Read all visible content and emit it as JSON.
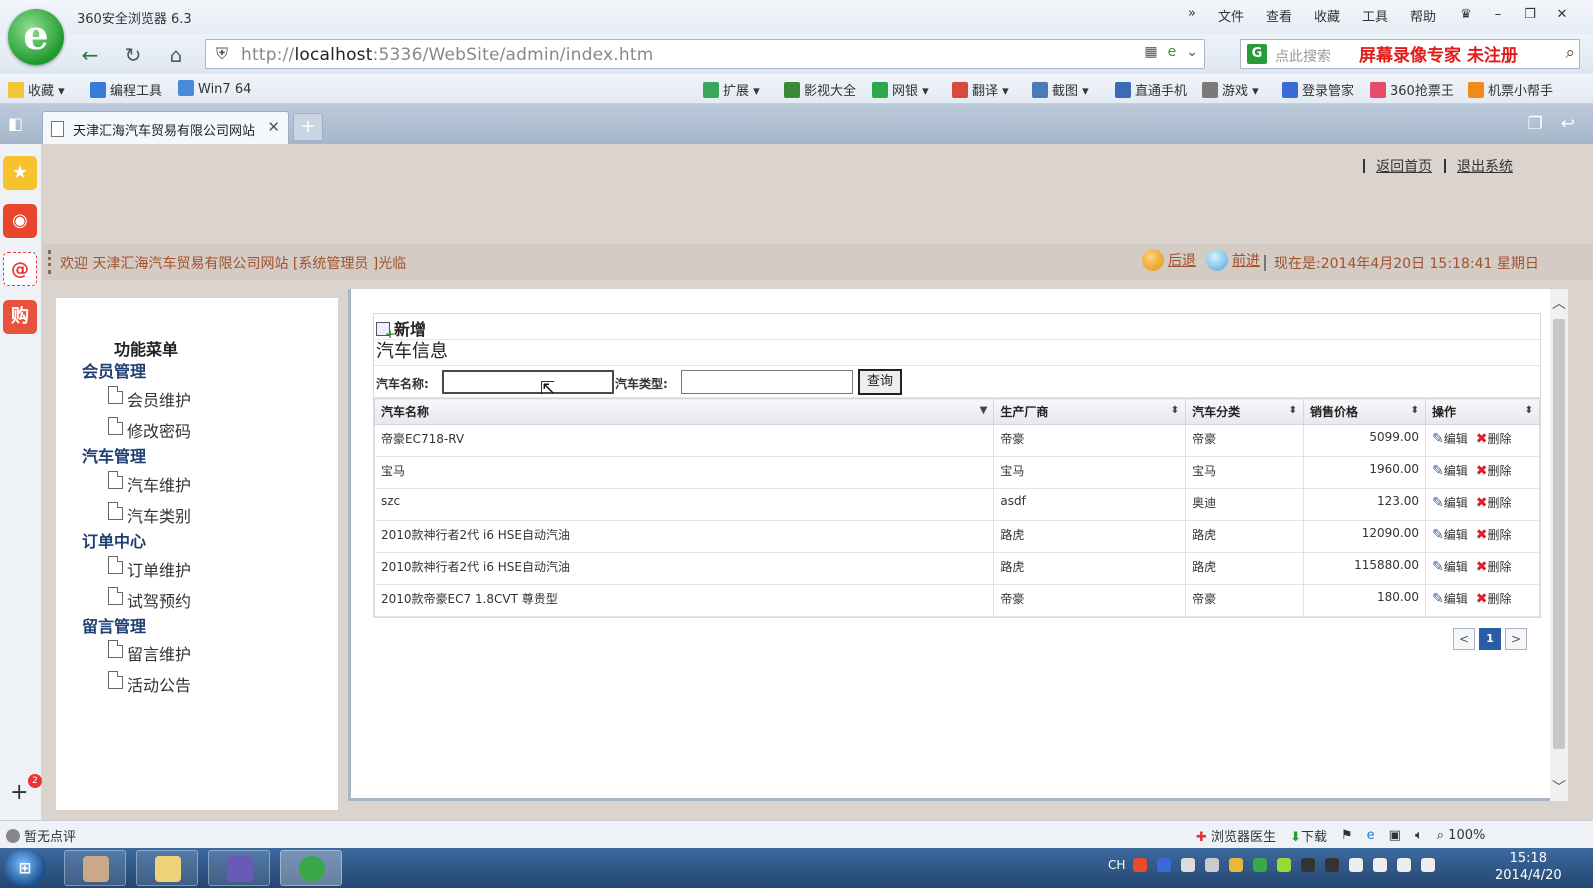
{
  "browser": {
    "title": "360安全浏览器 6.3",
    "logo_glyph": "e",
    "top_menu": [
      "文件",
      "查看",
      "收藏",
      "工具",
      "帮助"
    ],
    "url_host": "localhost",
    "url_prefix": "http://",
    "url_rest": ":5336/WebSite/admin/index.htm",
    "search_placeholder": "点此搜索",
    "watermark": "屏幕录像专家  未注册",
    "favorites": [
      "收藏",
      "编程工具",
      "Win7 64",
      "扩展",
      "影视大全",
      "网银",
      "翻译",
      "截图",
      "直通手机",
      "游戏",
      "登录管家",
      "360抢票王",
      "机票小帮手"
    ],
    "tab_title": "天津汇海汽车贸易有限公司网站",
    "dock_badge": "2"
  },
  "header": {
    "home_link": "返回首页",
    "logout_link": "退出系统",
    "welcome": "欢迎  天津汇海汽车贸易有限公司网站 [系统管理员 ]光临",
    "back": "后退",
    "forward": "前进",
    "now": "现在是:2014年4月20日  15:18:41 星期日"
  },
  "menu": {
    "title": "功能菜单",
    "groups": [
      {
        "label": "会员管理",
        "items": [
          "会员维护",
          "修改密码"
        ]
      },
      {
        "label": "汽车管理",
        "items": [
          "汽车维护",
          "汽车类别"
        ]
      },
      {
        "label": "订单中心",
        "items": [
          "订单维护",
          "试驾预约"
        ]
      },
      {
        "label": "留言管理",
        "items": [
          "留言维护",
          "活动公告"
        ]
      }
    ]
  },
  "grid": {
    "add_label": "新增",
    "title": "汽车信息",
    "name_label": "汽车名称:",
    "type_label": "汽车类型:",
    "query_label": "查询",
    "columns": [
      "汽车名称",
      "生产厂商",
      "汽车分类",
      "销售价格",
      "操作"
    ],
    "edit_label": "编辑",
    "delete_label": "删除",
    "rows": [
      {
        "name": "帝豪EC718-RV",
        "maker": "帝豪",
        "category": "帝豪",
        "price": "5099.00"
      },
      {
        "name": "宝马",
        "maker": "宝马",
        "category": "宝马",
        "price": "1960.00"
      },
      {
        "name": "szc",
        "maker": "asdf",
        "category": "奥迪",
        "price": "123.00"
      },
      {
        "name": "2010款神行者2代 i6 HSE自动汽油",
        "maker": "路虎",
        "category": "路虎",
        "price": "12090.00"
      },
      {
        "name": "2010款神行者2代 i6 HSE自动汽油",
        "maker": "路虎",
        "category": "路虎",
        "price": "115880.00"
      },
      {
        "name": "2010款帝豪EC7 1.8CVT 尊贵型",
        "maker": "帝豪",
        "category": "帝豪",
        "price": "180.00"
      }
    ],
    "pager": {
      "prev": "<",
      "current": "1",
      "next": ">"
    }
  },
  "status": {
    "left": "暂无点评",
    "doctor": "浏览器医生",
    "download": "下载",
    "zoom": "100%"
  },
  "taskbar": {
    "lang": "CH",
    "time": "15:18",
    "date": "2014/4/20"
  }
}
